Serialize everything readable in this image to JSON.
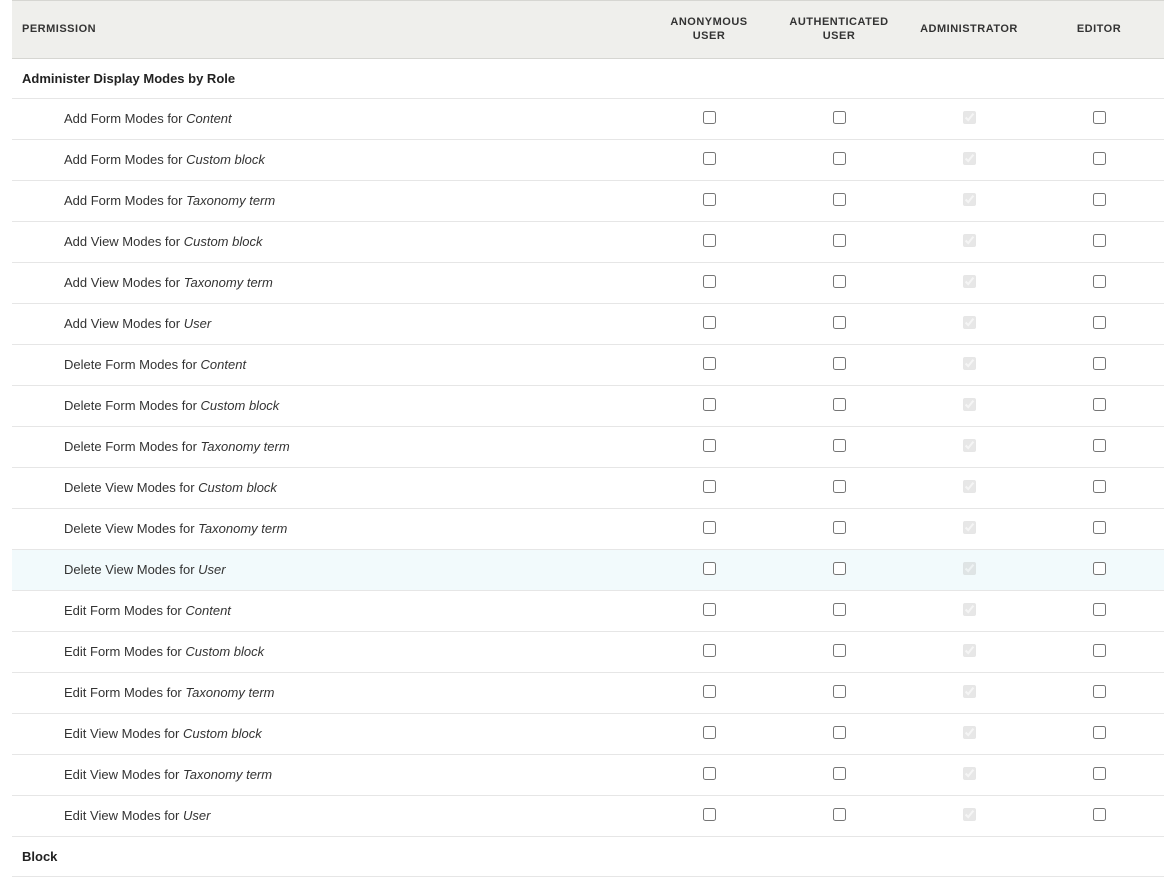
{
  "header": {
    "permission": "PERMISSION",
    "roles": [
      "ANONYMOUS USER",
      "AUTHENTICATED USER",
      "ADMINISTRATOR",
      "EDITOR"
    ]
  },
  "sections": [
    {
      "title": "Administer Display Modes by Role",
      "rows": [
        {
          "prefix": "Add Form Modes for ",
          "italic": "Content",
          "anon": false,
          "auth": false,
          "admin": true,
          "editor": false,
          "hover": false
        },
        {
          "prefix": "Add Form Modes for ",
          "italic": "Custom block",
          "anon": false,
          "auth": false,
          "admin": true,
          "editor": false,
          "hover": false
        },
        {
          "prefix": "Add Form Modes for ",
          "italic": "Taxonomy term",
          "anon": false,
          "auth": false,
          "admin": true,
          "editor": false,
          "hover": false
        },
        {
          "prefix": "Add View Modes for ",
          "italic": "Custom block",
          "anon": false,
          "auth": false,
          "admin": true,
          "editor": false,
          "hover": false
        },
        {
          "prefix": "Add View Modes for ",
          "italic": "Taxonomy term",
          "anon": false,
          "auth": false,
          "admin": true,
          "editor": false,
          "hover": false
        },
        {
          "prefix": "Add View Modes for ",
          "italic": "User",
          "anon": false,
          "auth": false,
          "admin": true,
          "editor": false,
          "hover": false
        },
        {
          "prefix": "Delete Form Modes for ",
          "italic": "Content",
          "anon": false,
          "auth": false,
          "admin": true,
          "editor": false,
          "hover": false
        },
        {
          "prefix": "Delete Form Modes for ",
          "italic": "Custom block",
          "anon": false,
          "auth": false,
          "admin": true,
          "editor": false,
          "hover": false
        },
        {
          "prefix": "Delete Form Modes for ",
          "italic": "Taxonomy term",
          "anon": false,
          "auth": false,
          "admin": true,
          "editor": false,
          "hover": false
        },
        {
          "prefix": "Delete View Modes for ",
          "italic": "Custom block",
          "anon": false,
          "auth": false,
          "admin": true,
          "editor": false,
          "hover": false
        },
        {
          "prefix": "Delete View Modes for ",
          "italic": "Taxonomy term",
          "anon": false,
          "auth": false,
          "admin": true,
          "editor": false,
          "hover": false
        },
        {
          "prefix": "Delete View Modes for ",
          "italic": "User",
          "anon": false,
          "auth": false,
          "admin": true,
          "editor": false,
          "hover": true
        },
        {
          "prefix": "Edit Form Modes for ",
          "italic": "Content",
          "anon": false,
          "auth": false,
          "admin": true,
          "editor": false,
          "hover": false
        },
        {
          "prefix": "Edit Form Modes for ",
          "italic": "Custom block",
          "anon": false,
          "auth": false,
          "admin": true,
          "editor": false,
          "hover": false
        },
        {
          "prefix": "Edit Form Modes for ",
          "italic": "Taxonomy term",
          "anon": false,
          "auth": false,
          "admin": true,
          "editor": false,
          "hover": false
        },
        {
          "prefix": "Edit View Modes for ",
          "italic": "Custom block",
          "anon": false,
          "auth": false,
          "admin": true,
          "editor": false,
          "hover": false
        },
        {
          "prefix": "Edit View Modes for ",
          "italic": "Taxonomy term",
          "anon": false,
          "auth": false,
          "admin": true,
          "editor": false,
          "hover": false
        },
        {
          "prefix": "Edit View Modes for ",
          "italic": "User",
          "anon": false,
          "auth": false,
          "admin": true,
          "editor": false,
          "hover": false
        }
      ]
    },
    {
      "title": "Block",
      "rows": []
    }
  ]
}
